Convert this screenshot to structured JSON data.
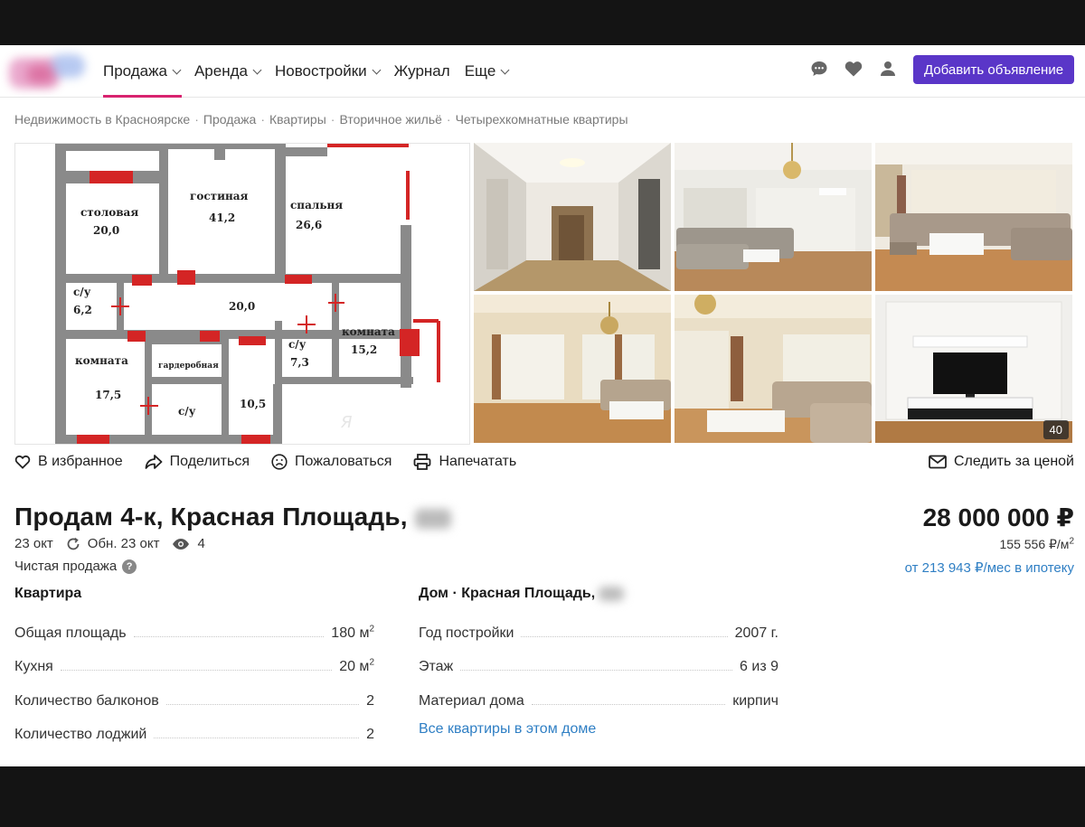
{
  "header": {
    "nav": [
      {
        "label": "Продажа",
        "dropdown": true,
        "active": true
      },
      {
        "label": "Аренда",
        "dropdown": true
      },
      {
        "label": "Новостройки",
        "dropdown": true
      },
      {
        "label": "Журнал",
        "dropdown": false
      },
      {
        "label": "Еще",
        "dropdown": true
      }
    ],
    "icons": [
      "chat-icon",
      "heart-icon",
      "user-icon"
    ],
    "add_button": "Добавить объявление",
    "accent": "#5a36c8",
    "active_color": "#d8236f"
  },
  "breadcrumbs": [
    "Недвижимость в Красноярске",
    "Продажа",
    "Квартиры",
    "Вторичное жильё",
    "Четырехкомнатные квартиры"
  ],
  "floorplan": {
    "rooms": [
      {
        "name": "столовая",
        "area": "20,0"
      },
      {
        "name": "гостиная",
        "area": "41,2"
      },
      {
        "name": "спальня",
        "area": "26,6"
      },
      {
        "name": "с/у",
        "area": "6,2"
      },
      {
        "name": "",
        "area": "20,0"
      },
      {
        "name": "с/у",
        "area": "7,3"
      },
      {
        "name": "комната",
        "area": "15,2"
      },
      {
        "name": "комната",
        "area": "17,5"
      },
      {
        "name": "гардеробная",
        "area": ""
      },
      {
        "name": "с/у",
        "area": ""
      },
      {
        "name": "",
        "area": "10,5"
      }
    ]
  },
  "gallery": {
    "photo_count": "40"
  },
  "actions": {
    "favorite": "В избранное",
    "share": "Поделиться",
    "report": "Пожаловаться",
    "print": "Напечатать",
    "follow_price": "Следить за ценой"
  },
  "listing": {
    "title": "Продам 4-к, Красная Площадь,",
    "date": "23 окт",
    "updated": "Обн. 23 окт",
    "views": "4",
    "sale_type": "Чистая продажа",
    "price": "28 000 000 ₽",
    "price_per_m2": "155 556 ₽/м²",
    "mortgage": "от 213 943 ₽/мес в ипотеку"
  },
  "apartment": {
    "title": "Квартира",
    "rows": [
      {
        "label": "Общая площадь",
        "value": "180 м²"
      },
      {
        "label": "Кухня",
        "value": "20 м²"
      },
      {
        "label": "Количество балконов",
        "value": "2"
      },
      {
        "label": "Количество лоджий",
        "value": "2"
      }
    ]
  },
  "house": {
    "title": "Дом · Красная Площадь,",
    "rows": [
      {
        "label": "Год постройки",
        "value": "2007 г."
      },
      {
        "label": "Этаж",
        "value": "6 из 9"
      },
      {
        "label": "Материал дома",
        "value": "кирпич"
      }
    ],
    "all_link": "Все квартиры в этом доме"
  }
}
